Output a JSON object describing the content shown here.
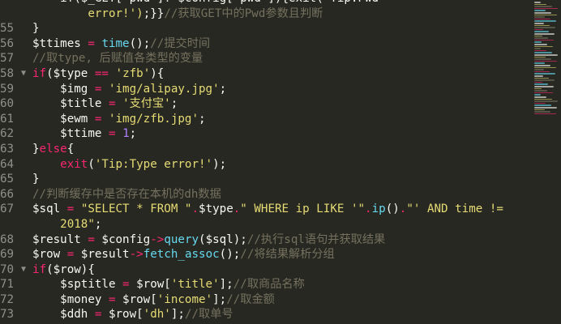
{
  "lines": [
    {
      "num": "",
      "fold": false,
      "tokens": [
        {
          "t": "    if($_GET['pwd']!=$config['pwd']){exit('Tip:Pwd",
          "c": "pl"
        },
        {
          "t": "",
          "c": "pl"
        }
      ]
    },
    {
      "num": "",
      "fold": false,
      "tokens": [
        {
          "t": "        ",
          "c": "pl"
        },
        {
          "t": "error!')",
          "c": "st"
        },
        {
          "t": ";}}",
          "c": "pl"
        },
        {
          "t": "//获取GET中的Pwd参数且判断",
          "c": "cm"
        }
      ]
    },
    {
      "num": "55",
      "fold": false,
      "tokens": [
        {
          "t": "}",
          "c": "pl"
        }
      ]
    },
    {
      "num": "56",
      "fold": false,
      "tokens": [
        {
          "t": "$ttimes ",
          "c": "pl"
        },
        {
          "t": "=",
          "c": "op"
        },
        {
          "t": " ",
          "c": "pl"
        },
        {
          "t": "time",
          "c": "fn"
        },
        {
          "t": "();",
          "c": "pl"
        },
        {
          "t": "//提交时间",
          "c": "cm"
        }
      ]
    },
    {
      "num": "57",
      "fold": false,
      "tokens": [
        {
          "t": "//取type, 后赋值各类型的变量",
          "c": "cm"
        }
      ]
    },
    {
      "num": "58",
      "fold": true,
      "tokens": [
        {
          "t": "if",
          "c": "kw"
        },
        {
          "t": "($type ",
          "c": "pl"
        },
        {
          "t": "==",
          "c": "op"
        },
        {
          "t": " ",
          "c": "pl"
        },
        {
          "t": "'zfb'",
          "c": "st"
        },
        {
          "t": "){",
          "c": "pl"
        }
      ]
    },
    {
      "num": "59",
      "fold": false,
      "tokens": [
        {
          "t": "    $img ",
          "c": "pl"
        },
        {
          "t": "=",
          "c": "op"
        },
        {
          "t": " ",
          "c": "pl"
        },
        {
          "t": "'img/alipay.jpg'",
          "c": "st"
        },
        {
          "t": ";",
          "c": "pl"
        }
      ]
    },
    {
      "num": "60",
      "fold": false,
      "tokens": [
        {
          "t": "    $title ",
          "c": "pl"
        },
        {
          "t": "=",
          "c": "op"
        },
        {
          "t": " ",
          "c": "pl"
        },
        {
          "t": "'支付宝'",
          "c": "st"
        },
        {
          "t": ";",
          "c": "pl"
        }
      ]
    },
    {
      "num": "61",
      "fold": false,
      "tokens": [
        {
          "t": "    $ewm ",
          "c": "pl"
        },
        {
          "t": "=",
          "c": "op"
        },
        {
          "t": " ",
          "c": "pl"
        },
        {
          "t": "'img/zfb.jpg'",
          "c": "st"
        },
        {
          "t": ";",
          "c": "pl"
        }
      ]
    },
    {
      "num": "62",
      "fold": false,
      "tokens": [
        {
          "t": "    $ttime ",
          "c": "pl"
        },
        {
          "t": "=",
          "c": "op"
        },
        {
          "t": " ",
          "c": "pl"
        },
        {
          "t": "1",
          "c": "nm"
        },
        {
          "t": ";",
          "c": "pl"
        }
      ]
    },
    {
      "num": "63",
      "fold": false,
      "tokens": [
        {
          "t": "}",
          "c": "pl"
        },
        {
          "t": "else",
          "c": "kw"
        },
        {
          "t": "{",
          "c": "pl"
        }
      ]
    },
    {
      "num": "64",
      "fold": false,
      "tokens": [
        {
          "t": "    ",
          "c": "pl"
        },
        {
          "t": "exit",
          "c": "kw"
        },
        {
          "t": "(",
          "c": "pl"
        },
        {
          "t": "'Tip:Type error!'",
          "c": "st"
        },
        {
          "t": ");",
          "c": "pl"
        }
      ]
    },
    {
      "num": "65",
      "fold": false,
      "tokens": [
        {
          "t": "}",
          "c": "pl"
        }
      ]
    },
    {
      "num": "66",
      "fold": false,
      "tokens": [
        {
          "t": "//判断缓存中是否存在本机的dh数据",
          "c": "cm"
        }
      ]
    },
    {
      "num": "67",
      "fold": false,
      "tokens": [
        {
          "t": "$sql ",
          "c": "pl"
        },
        {
          "t": "=",
          "c": "op"
        },
        {
          "t": " ",
          "c": "pl"
        },
        {
          "t": "\"SELECT * FROM \"",
          "c": "st"
        },
        {
          "t": ".",
          "c": "op"
        },
        {
          "t": "$type",
          "c": "pl"
        },
        {
          "t": ".",
          "c": "op"
        },
        {
          "t": "\" WHERE ip LIKE '\"",
          "c": "st"
        },
        {
          "t": ".",
          "c": "op"
        },
        {
          "t": "ip",
          "c": "fn"
        },
        {
          "t": "()",
          "c": "pl"
        },
        {
          "t": ".",
          "c": "op"
        },
        {
          "t": "\"' AND time !=",
          "c": "st"
        }
      ]
    },
    {
      "num": "",
      "fold": false,
      "tokens": [
        {
          "t": "    ",
          "c": "pl"
        },
        {
          "t": "2018\"",
          "c": "st"
        },
        {
          "t": ";",
          "c": "pl"
        }
      ]
    },
    {
      "num": "68",
      "fold": false,
      "tokens": [
        {
          "t": "$result ",
          "c": "pl"
        },
        {
          "t": "=",
          "c": "op"
        },
        {
          "t": " $config",
          "c": "pl"
        },
        {
          "t": "->",
          "c": "op"
        },
        {
          "t": "query",
          "c": "fn"
        },
        {
          "t": "($sql);",
          "c": "pl"
        },
        {
          "t": "//执行sql语句并获取结果",
          "c": "cm"
        }
      ]
    },
    {
      "num": "69",
      "fold": false,
      "tokens": [
        {
          "t": "$row ",
          "c": "pl"
        },
        {
          "t": "=",
          "c": "op"
        },
        {
          "t": " $result",
          "c": "pl"
        },
        {
          "t": "->",
          "c": "op"
        },
        {
          "t": "fetch_assoc",
          "c": "fn"
        },
        {
          "t": "();",
          "c": "pl"
        },
        {
          "t": "//将结果解析分组",
          "c": "cm"
        }
      ]
    },
    {
      "num": "70",
      "fold": true,
      "tokens": [
        {
          "t": "if",
          "c": "kw"
        },
        {
          "t": "($row){",
          "c": "pl"
        }
      ]
    },
    {
      "num": "71",
      "fold": false,
      "tokens": [
        {
          "t": "    $sptitle ",
          "c": "pl"
        },
        {
          "t": "=",
          "c": "op"
        },
        {
          "t": " $row[",
          "c": "pl"
        },
        {
          "t": "'title'",
          "c": "st"
        },
        {
          "t": "];",
          "c": "pl"
        },
        {
          "t": "//取商品名称",
          "c": "cm"
        }
      ]
    },
    {
      "num": "72",
      "fold": false,
      "tokens": [
        {
          "t": "    $money ",
          "c": "pl"
        },
        {
          "t": "=",
          "c": "op"
        },
        {
          "t": " $row[",
          "c": "pl"
        },
        {
          "t": "'income'",
          "c": "st"
        },
        {
          "t": "];",
          "c": "pl"
        },
        {
          "t": "//取金额",
          "c": "cm"
        }
      ]
    },
    {
      "num": "73",
      "fold": false,
      "tokens": [
        {
          "t": "    $ddh ",
          "c": "pl"
        },
        {
          "t": "=",
          "c": "op"
        },
        {
          "t": " $row[",
          "c": "pl"
        },
        {
          "t": "'dh'",
          "c": "st"
        },
        {
          "t": "];",
          "c": "pl"
        },
        {
          "t": "//取单号",
          "c": "cm"
        }
      ]
    }
  ],
  "colors": {
    "background": "#272822",
    "keyword": "#f92672",
    "function": "#66d9ef",
    "string": "#e6db74",
    "number": "#ae81ff",
    "comment": "#75715e",
    "text": "#f8f8f2",
    "gutter": "#90908a"
  },
  "fold_icon": "fold-arrow-icon"
}
